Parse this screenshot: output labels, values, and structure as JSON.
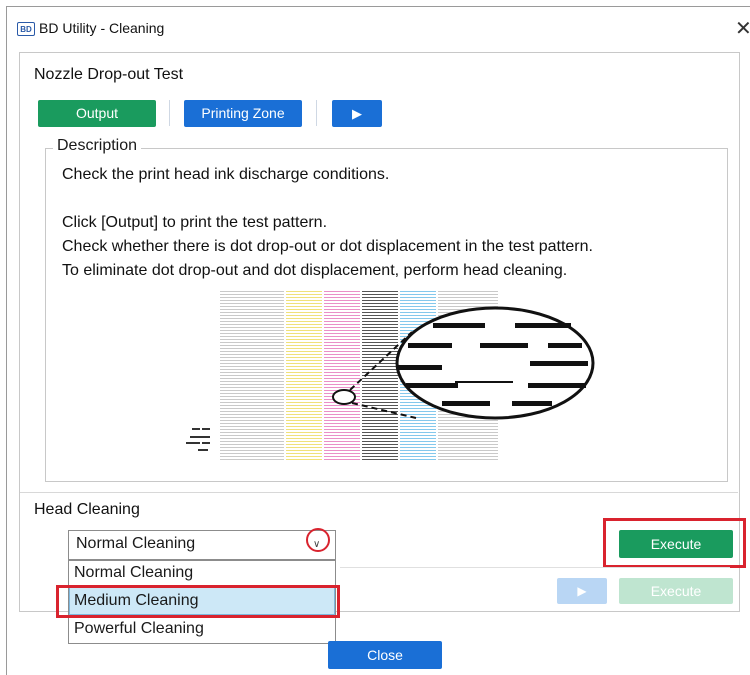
{
  "window": {
    "logo_text": "BD",
    "title": "BD Utility - Cleaning",
    "close_glyph": "✕"
  },
  "nozzle_test": {
    "title": "Nozzle Drop-out Test",
    "output_label": "Output",
    "printing_zone_label": "Printing Zone",
    "play_glyph": "▶"
  },
  "description": {
    "legend": "Description",
    "lines": [
      "Check the print head ink discharge conditions.",
      "Click [Output] to print the test pattern.",
      "Check whether there is dot drop-out or dot displacement in the test pattern.",
      "To eliminate dot drop-out and dot displacement, perform head cleaning."
    ]
  },
  "head_cleaning": {
    "title": "Head Cleaning",
    "selected": "Normal Cleaning",
    "options": [
      "Normal Cleaning",
      "Medium Cleaning",
      "Powerful Cleaning"
    ],
    "highlighted_index": 1,
    "execute_label": "Execute",
    "secondary_execute_label": "Execute",
    "secondary_play_glyph": "▶"
  },
  "footer": {
    "close_label": "Close"
  },
  "colors": {
    "green": "#1a9b5e",
    "blue": "#1a6fd6",
    "annotation_red": "#d9232e",
    "highlight": "#cde8f7"
  }
}
